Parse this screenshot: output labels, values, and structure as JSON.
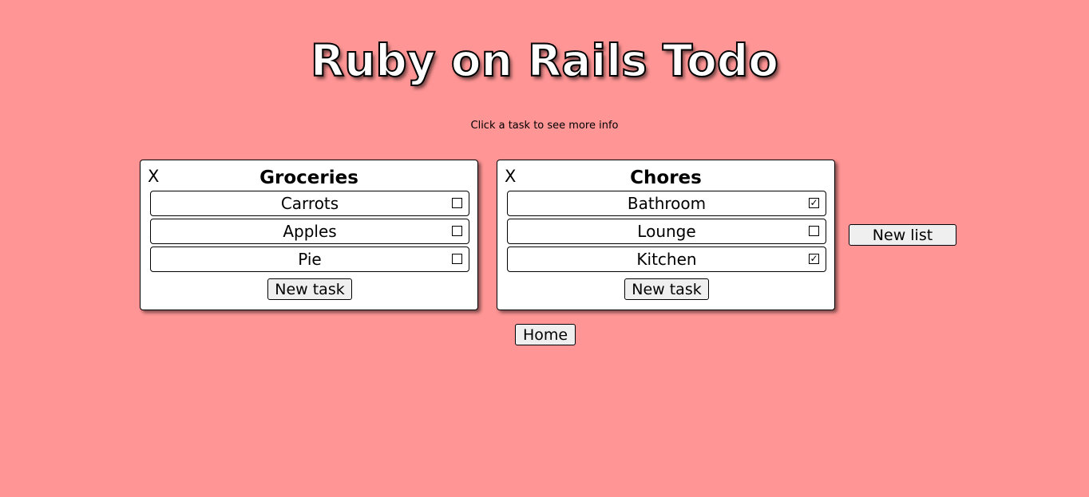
{
  "header": {
    "title": "Ruby on Rails Todo",
    "subtitle": "Click a task to see more info"
  },
  "colors": {
    "background": "#ff9595",
    "card": "#ffffff",
    "button": "#efefef"
  },
  "lists": [
    {
      "delete_label": "X",
      "title": "Groceries",
      "tasks": [
        {
          "name": "Carrots",
          "check": "",
          "done": false
        },
        {
          "name": "Apples",
          "check": "",
          "done": false
        },
        {
          "name": "Pie",
          "check": "",
          "done": false
        }
      ],
      "new_task_label": "New task"
    },
    {
      "delete_label": "X",
      "title": "Chores",
      "tasks": [
        {
          "name": "Bathroom",
          "check": "✓",
          "done": true
        },
        {
          "name": "Lounge",
          "check": "",
          "done": false
        },
        {
          "name": "Kitchen",
          "check": "✓",
          "done": true
        }
      ],
      "new_task_label": "New task"
    }
  ],
  "new_list_label": "New list",
  "home_label": "Home"
}
